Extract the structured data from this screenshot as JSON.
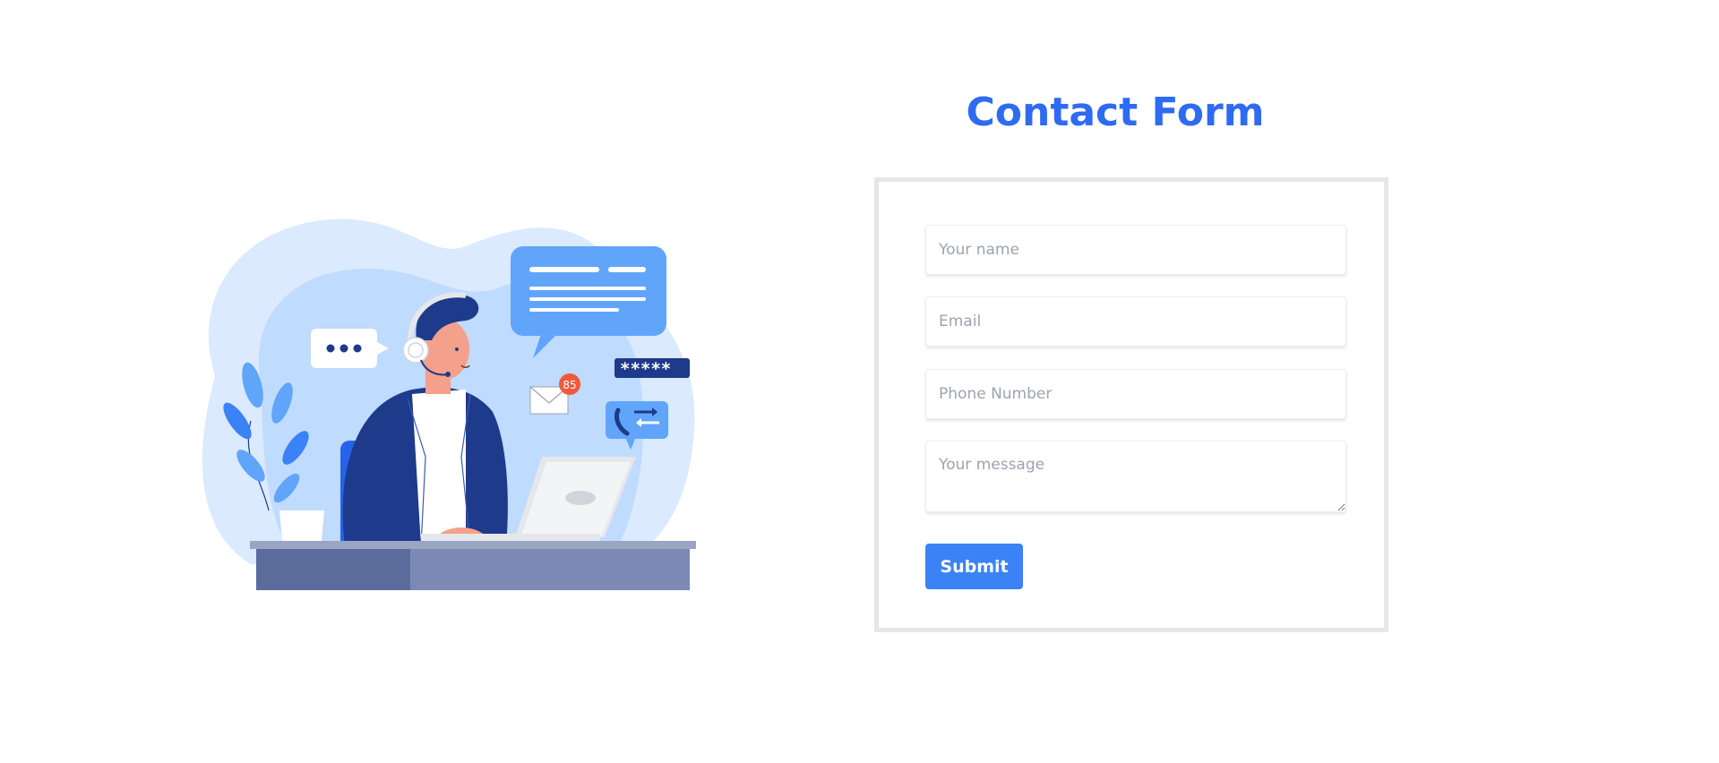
{
  "form": {
    "title": "Contact Form",
    "fields": {
      "name_placeholder": "Your name",
      "email_placeholder": "Email",
      "phone_placeholder": "Phone Number",
      "message_placeholder": "Your message"
    },
    "submit_label": "Submit"
  },
  "illustration": {
    "subject": "customer-support-agent-illustration",
    "mail_badge_count": "85",
    "password_mask": "*****",
    "colors": {
      "primary": "#3b82f6",
      "navy": "#1e3a8a",
      "light_blue": "#dbeafe",
      "badge_red": "#ef5a3c"
    }
  },
  "colors": {
    "title": "#2f6bf2",
    "button": "#3b82f6",
    "card_border": "#e5e7eb"
  }
}
